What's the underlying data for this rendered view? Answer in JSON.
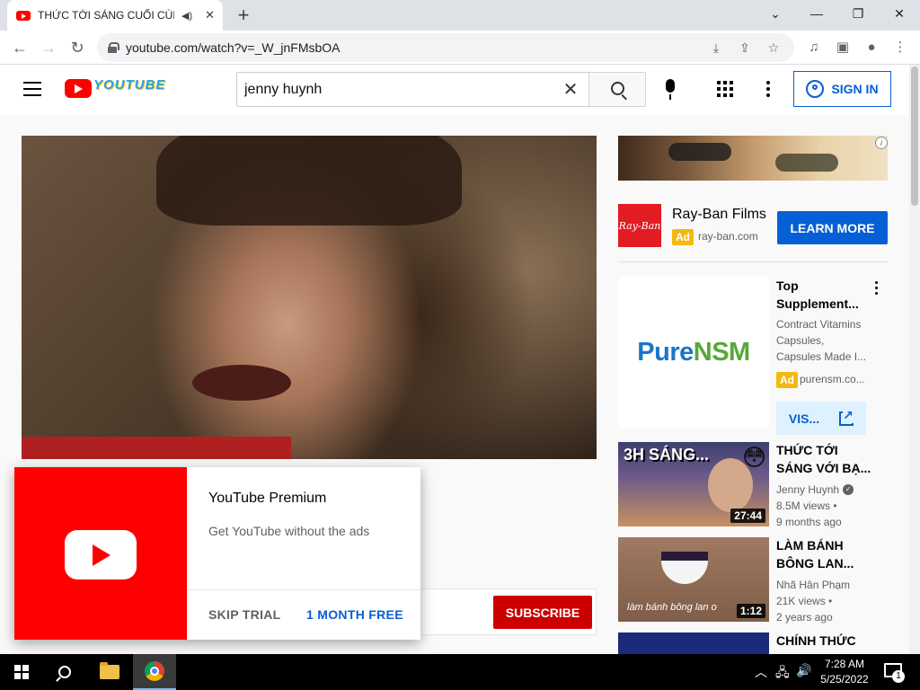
{
  "browser": {
    "tab_title": "THỨC TỚI SÁNG CUỐI CÙNG",
    "url": "youtube.com/watch?v=_W_jnFMsbOA",
    "new_tab_label": "+",
    "tab_close": "✕",
    "sound_icon": "speaker-icon"
  },
  "header": {
    "search_value": "jenny huynh",
    "sign_in_label": "SIGN IN",
    "doodle_text": "YOUTUBE"
  },
  "premium_popup": {
    "title": "YouTube Premium",
    "description": "Get YouTube without the ads",
    "skip_label": "SKIP TRIAL",
    "cta_label": "1 MONTH FREE"
  },
  "subscribe_label": "SUBSCRIBE",
  "ad_banner": {
    "advertiser": "Ray-Ban Films",
    "logo_text": "Ray-Ban",
    "badge": "Ad",
    "domain": "ray-ban.com",
    "cta": "LEARN MORE"
  },
  "ad_card": {
    "image_text_blue": "Pure",
    "image_text_green": "NSM",
    "title": "Top Supplement...",
    "description": "Contract Vitamins Capsules, Capsules Made I...",
    "badge": "Ad",
    "domain": "purensm.co...",
    "cta": "VIS..."
  },
  "videos": [
    {
      "thumb_text": "3H SÁNG...",
      "emoji": "😳",
      "duration": "27:44",
      "title": "THỨC TỚI SÁNG VỚI BẠ...",
      "channel": "Jenny Huynh",
      "verified_mark": "✓",
      "views": "8.5M views •",
      "age": "9 months ago"
    },
    {
      "thumb_caption": "làm bánh bông lan o",
      "duration": "1:12",
      "title": "LÀM BÁNH BÔNG LAN...",
      "channel": "Nhã Hân Phạm",
      "views": "21K views •",
      "age": "2 years ago"
    },
    {
      "title": "CHÍNH THỨC"
    }
  ],
  "taskbar": {
    "time": "7:28 AM",
    "date": "5/25/2022",
    "notification_count": "1"
  },
  "colors": {
    "youtube_red": "#ff0000",
    "subscribe_red": "#cc0000",
    "link_blue": "#065fd4",
    "ad_yellow": "#f2b90f"
  }
}
